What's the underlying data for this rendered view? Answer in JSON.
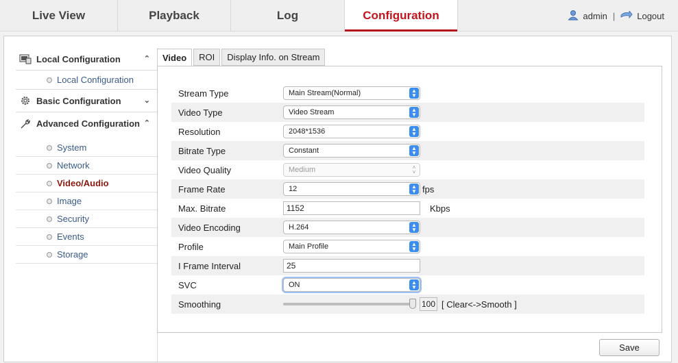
{
  "nav": {
    "tabs": [
      {
        "label": "Live View"
      },
      {
        "label": "Playback"
      },
      {
        "label": "Log"
      },
      {
        "label": "Configuration"
      }
    ],
    "user": "admin",
    "separator": "|",
    "logout": "Logout"
  },
  "sidebar": {
    "local": {
      "label": "Local Configuration",
      "chevron": "⌃",
      "sub": "Local Configuration"
    },
    "basic": {
      "label": "Basic Configuration",
      "chevron": "⌄"
    },
    "advanced": {
      "label": "Advanced Configuration",
      "chevron": "⌃"
    },
    "items": [
      {
        "label": "System"
      },
      {
        "label": "Network"
      },
      {
        "label": "Video/Audio"
      },
      {
        "label": "Image"
      },
      {
        "label": "Security"
      },
      {
        "label": "Events"
      },
      {
        "label": "Storage"
      }
    ]
  },
  "content_tabs": [
    {
      "label": "Video"
    },
    {
      "label": "ROI"
    },
    {
      "label": "Display Info. on Stream"
    }
  ],
  "form": {
    "stream_type": {
      "label": "Stream Type",
      "value": "Main Stream(Normal)"
    },
    "video_type": {
      "label": "Video Type",
      "value": "Video Stream"
    },
    "resolution": {
      "label": "Resolution",
      "value": "2048*1536"
    },
    "bitrate_type": {
      "label": "Bitrate Type",
      "value": "Constant"
    },
    "video_quality": {
      "label": "Video Quality",
      "value": "Medium"
    },
    "frame_rate": {
      "label": "Frame Rate",
      "value": "12",
      "unit": "fps"
    },
    "max_bitrate": {
      "label": "Max. Bitrate",
      "value": "1152",
      "unit": "Kbps"
    },
    "video_encoding": {
      "label": "Video Encoding",
      "value": "H.264"
    },
    "profile": {
      "label": "Profile",
      "value": "Main Profile"
    },
    "i_frame": {
      "label": "I Frame Interval",
      "value": "25"
    },
    "svc": {
      "label": "SVC",
      "value": "ON"
    },
    "smoothing": {
      "label": "Smoothing",
      "value": "100",
      "note": "[ Clear<->Smooth ]",
      "level": 100
    }
  },
  "save_label": "Save",
  "colors": {
    "accent": "#c3131c",
    "link": "#3a5b8a",
    "select_arrow": "#3b8df0"
  }
}
